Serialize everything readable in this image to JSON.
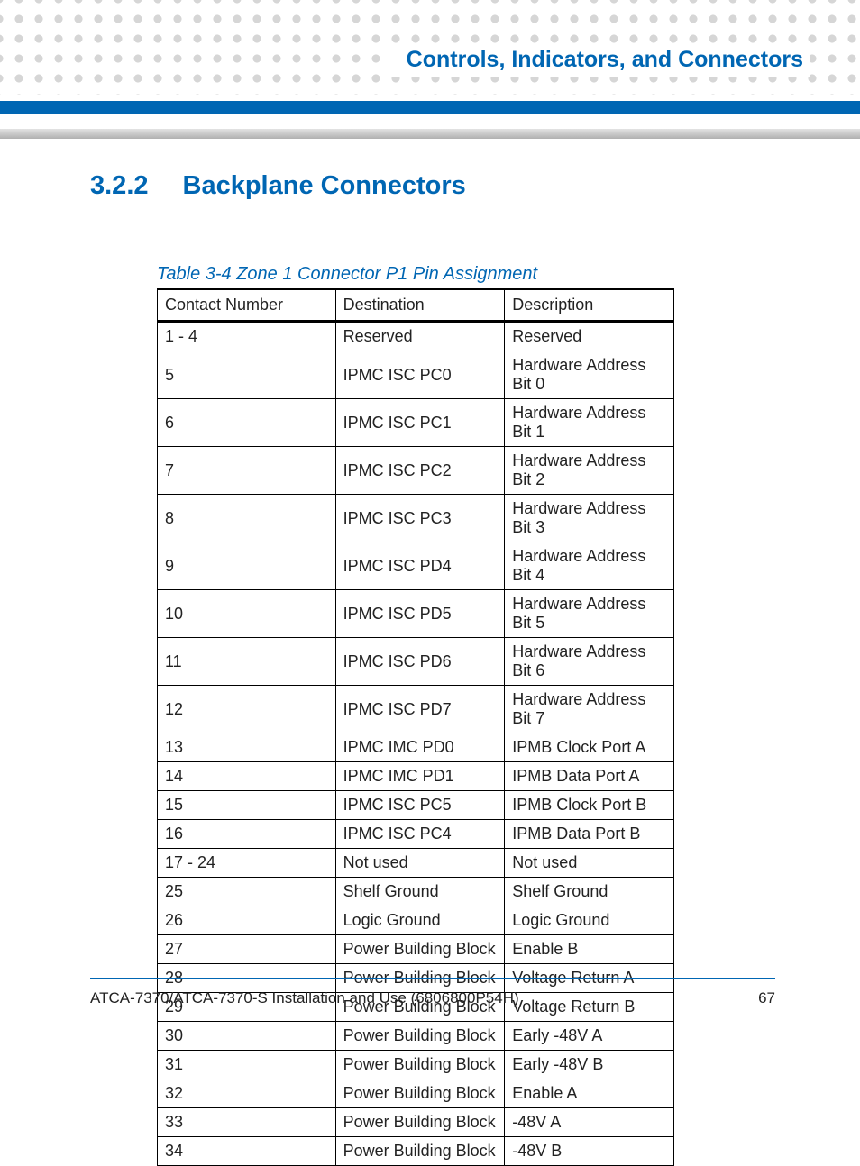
{
  "header": {
    "title": "Controls, Indicators, and Connectors"
  },
  "section": {
    "number": "3.2.2",
    "title": "Backplane Connectors"
  },
  "table": {
    "caption": "Table 3-4 Zone 1 Connector P1 Pin Assignment",
    "columns": [
      "Contact Number",
      "Destination",
      "Description"
    ],
    "rows": [
      {
        "contact": "1 - 4",
        "dest": "Reserved",
        "desc": "Reserved"
      },
      {
        "contact": "5",
        "dest": "IPMC ISC PC0",
        "desc": "Hardware Address Bit 0"
      },
      {
        "contact": "6",
        "dest": "IPMC ISC PC1",
        "desc": "Hardware Address Bit 1"
      },
      {
        "contact": "7",
        "dest": "IPMC ISC PC2",
        "desc": "Hardware Address Bit 2"
      },
      {
        "contact": "8",
        "dest": "IPMC ISC PC3",
        "desc": "Hardware Address Bit 3"
      },
      {
        "contact": "9",
        "dest": "IPMC ISC PD4",
        "desc": "Hardware Address Bit 4"
      },
      {
        "contact": "10",
        "dest": "IPMC ISC PD5",
        "desc": "Hardware Address Bit 5"
      },
      {
        "contact": "11",
        "dest": "IPMC ISC PD6",
        "desc": "Hardware Address Bit 6"
      },
      {
        "contact": "12",
        "dest": "IPMC ISC PD7",
        "desc": "Hardware Address Bit 7"
      },
      {
        "contact": "13",
        "dest": "IPMC IMC PD0",
        "desc": "IPMB Clock Port A"
      },
      {
        "contact": "14",
        "dest": "IPMC IMC PD1",
        "desc": "IPMB Data Port A"
      },
      {
        "contact": "15",
        "dest": "IPMC ISC PC5",
        "desc": "IPMB Clock Port B"
      },
      {
        "contact": "16",
        "dest": "IPMC ISC PC4",
        "desc": "IPMB Data Port B"
      },
      {
        "contact": "17 - 24",
        "dest": "Not used",
        "desc": "Not used"
      },
      {
        "contact": "25",
        "dest": "Shelf Ground",
        "desc": "Shelf Ground"
      },
      {
        "contact": "26",
        "dest": "Logic Ground",
        "desc": "Logic Ground"
      },
      {
        "contact": "27",
        "dest": "Power Building Block",
        "desc": "Enable B"
      },
      {
        "contact": "28",
        "dest": "Power Building Block",
        "desc": "Voltage Return A"
      },
      {
        "contact": "29",
        "dest": "Power Building Block",
        "desc": "Voltage Return B"
      },
      {
        "contact": "30",
        "dest": "Power Building Block",
        "desc": "Early -48V A"
      },
      {
        "contact": "31",
        "dest": "Power Building Block",
        "desc": "Early -48V B"
      },
      {
        "contact": "32",
        "dest": "Power Building Block",
        "desc": "Enable A"
      },
      {
        "contact": "33",
        "dest": "Power Building Block",
        "desc": "-48V A"
      },
      {
        "contact": "34",
        "dest": "Power Building Block",
        "desc": "-48V B"
      }
    ]
  },
  "footer": {
    "doc": "ATCA-7370/ATCA-7370-S Installation and Use (6806800P54H)",
    "page": "67"
  }
}
